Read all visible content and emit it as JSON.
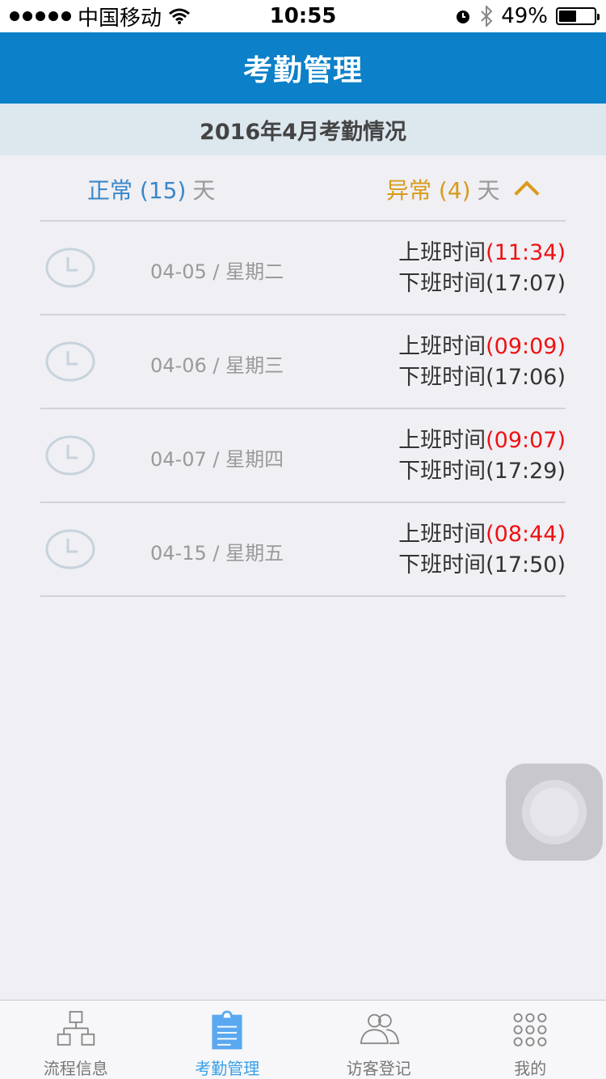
{
  "status_bar": {
    "carrier": "中国移动",
    "time": "10:55",
    "battery": "49%",
    "battery_level": 0.49
  },
  "nav": {
    "title": "考勤管理"
  },
  "banner": {
    "title": "2016年4月考勤情况"
  },
  "summary": {
    "normal_label": "正常 (15)",
    "abnormal_label": "异常 (4)",
    "unit": "天"
  },
  "records": [
    {
      "date": "04-05 / 星期二",
      "on_label": "上班时间",
      "on_time": "(11:34)",
      "off_text": "下班时间(17:07)"
    },
    {
      "date": "04-06 / 星期三",
      "on_label": "上班时间",
      "on_time": "(09:09)",
      "off_text": "下班时间(17:06)"
    },
    {
      "date": "04-07 / 星期四",
      "on_label": "上班时间",
      "on_time": "(09:07)",
      "off_text": "下班时间(17:29)"
    },
    {
      "date": "04-15 / 星期五",
      "on_label": "上班时间",
      "on_time": "(08:44)",
      "off_text": "下班时间(17:50)"
    }
  ],
  "tabs": [
    {
      "label": "流程信息",
      "icon": "org-chart-icon"
    },
    {
      "label": "考勤管理",
      "icon": "clipboard-icon"
    },
    {
      "label": "访客登记",
      "icon": "visitors-icon"
    },
    {
      "label": "我的",
      "icon": "grid-icon"
    }
  ],
  "colors": {
    "nav": "#0c80c8",
    "normal": "#3a87c8",
    "abnormal": "#d99a1a",
    "late": "#ee1111",
    "tab_active": "#3aa0e8"
  }
}
